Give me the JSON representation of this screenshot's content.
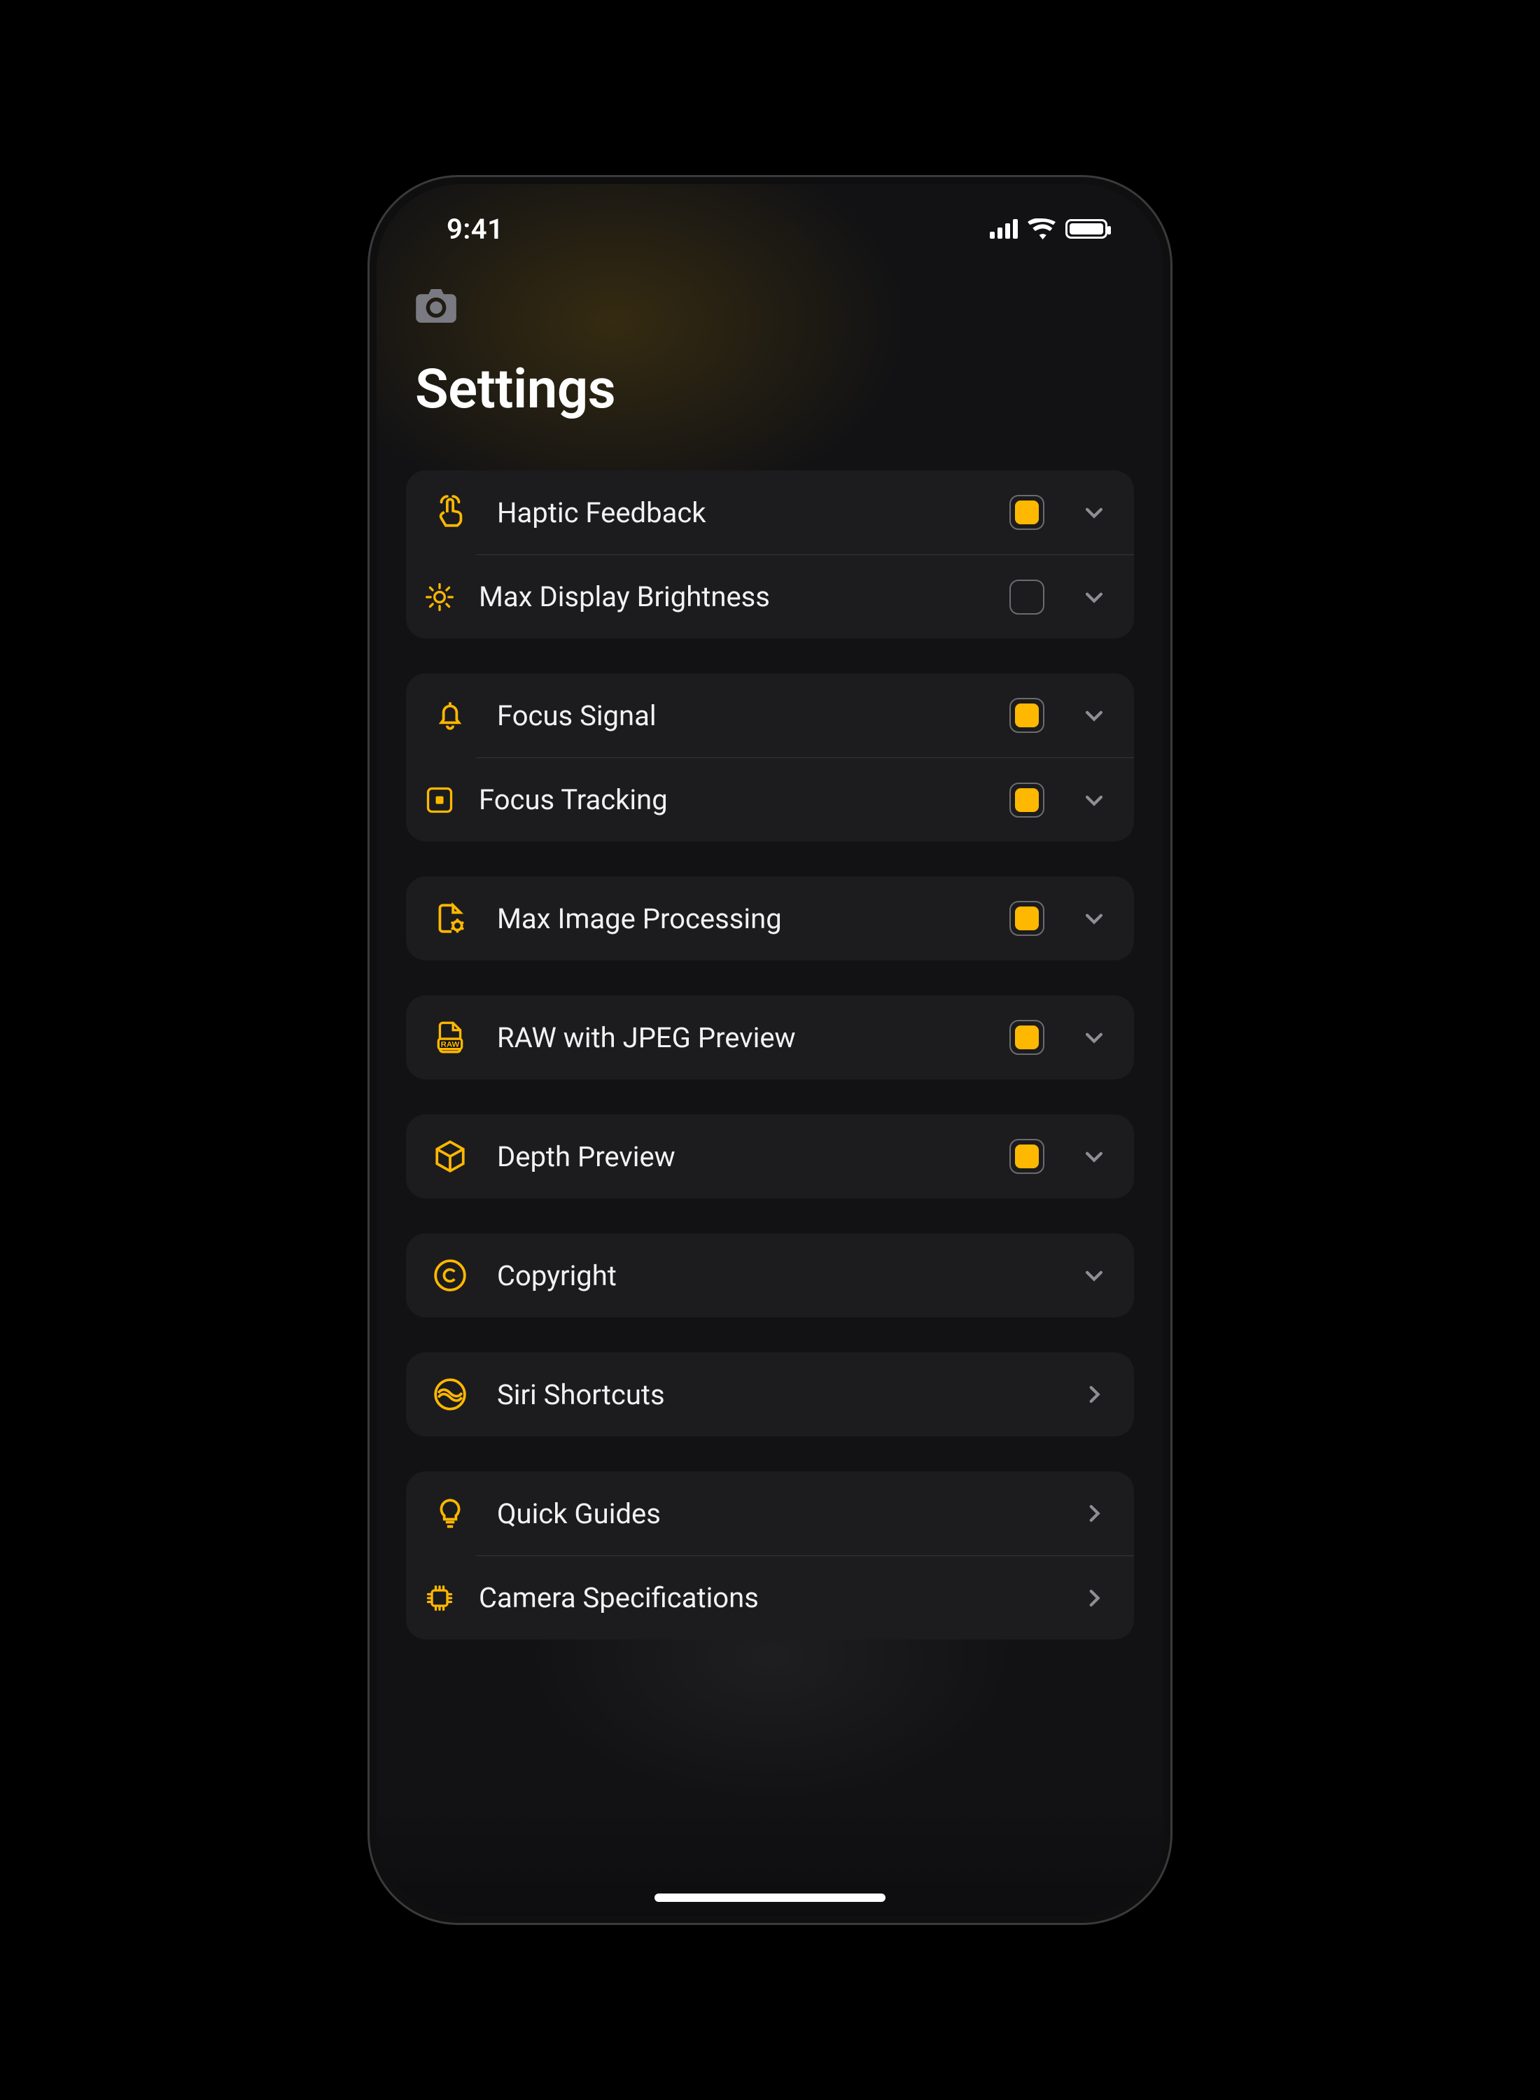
{
  "statusbar": {
    "time": "9:41"
  },
  "header": {
    "title": "Settings",
    "icon": "camera-icon"
  },
  "accent": "#ffb800",
  "groups": [
    {
      "rows": [
        {
          "id": "haptic-feedback",
          "icon": "touch-icon",
          "label": "Haptic Feedback",
          "checked": true,
          "expandable": true
        },
        {
          "id": "max-brightness",
          "icon": "sun-icon",
          "label": "Max Display Brightness",
          "checked": false,
          "expandable": true
        }
      ]
    },
    {
      "rows": [
        {
          "id": "focus-signal",
          "icon": "bell-icon",
          "label": "Focus Signal",
          "checked": true,
          "expandable": true
        },
        {
          "id": "focus-tracking",
          "icon": "target-square-icon",
          "label": "Focus Tracking",
          "checked": true,
          "expandable": true
        }
      ]
    },
    {
      "rows": [
        {
          "id": "max-processing",
          "icon": "file-gear-icon",
          "label": "Max Image Processing",
          "checked": true,
          "expandable": true
        }
      ]
    },
    {
      "rows": [
        {
          "id": "raw-jpeg",
          "icon": "raw-file-icon",
          "label": "RAW with JPEG Preview",
          "checked": true,
          "expandable": true
        }
      ]
    },
    {
      "rows": [
        {
          "id": "depth-preview",
          "icon": "cube-icon",
          "label": "Depth Preview",
          "checked": true,
          "expandable": true
        }
      ]
    },
    {
      "rows": [
        {
          "id": "copyright",
          "icon": "copyright-icon",
          "label": "Copyright",
          "checked": null,
          "expandable": true
        }
      ]
    },
    {
      "rows": [
        {
          "id": "siri-shortcuts",
          "icon": "siri-icon",
          "label": "Siri Shortcuts",
          "checked": null,
          "nav": true
        }
      ]
    },
    {
      "rows": [
        {
          "id": "quick-guides",
          "icon": "bulb-icon",
          "label": "Quick Guides",
          "checked": null,
          "nav": true
        },
        {
          "id": "camera-specs",
          "icon": "cpu-icon",
          "label": "Camera Specifications",
          "checked": null,
          "nav": true
        }
      ]
    }
  ]
}
